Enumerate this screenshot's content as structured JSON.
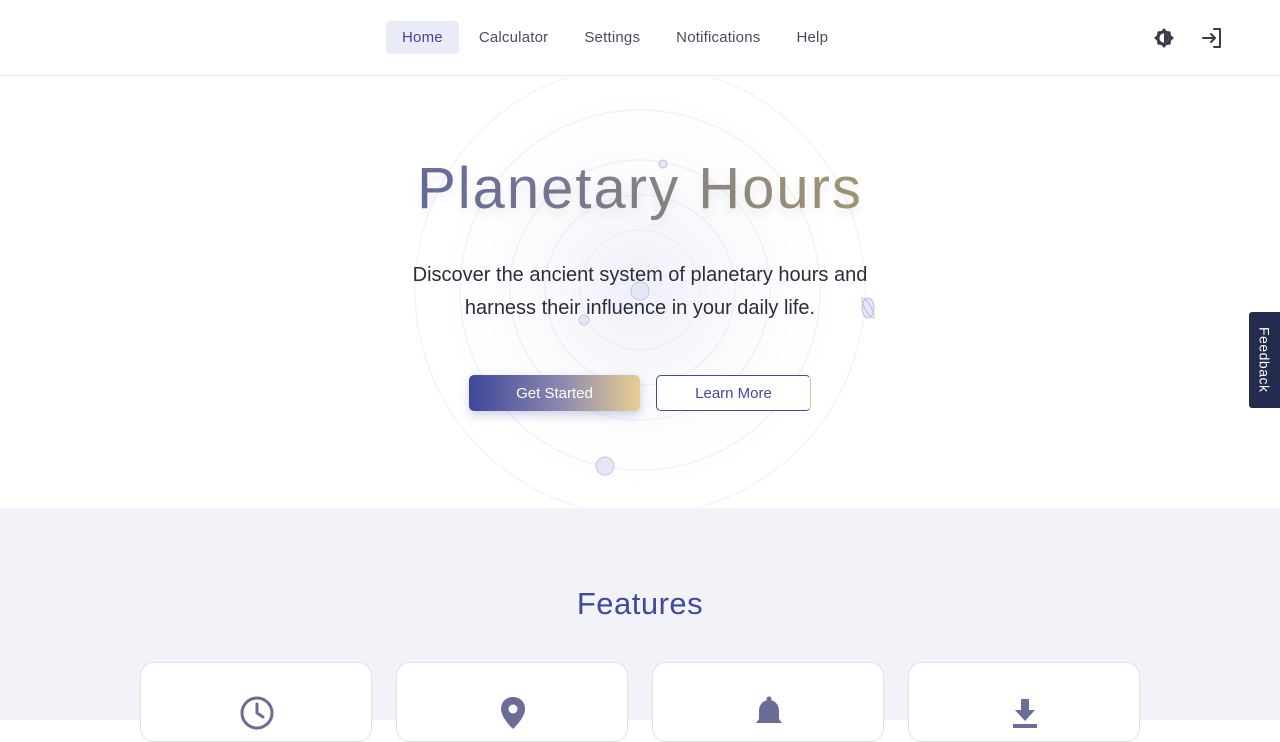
{
  "nav": {
    "items": [
      {
        "label": "Home",
        "active": true
      },
      {
        "label": "Calculator",
        "active": false
      },
      {
        "label": "Settings",
        "active": false
      },
      {
        "label": "Notifications",
        "active": false
      },
      {
        "label": "Help",
        "active": false
      }
    ],
    "icons": [
      "theme-toggle-icon",
      "login-icon"
    ]
  },
  "hero": {
    "title": "Planetary Hours",
    "subtitle": "Discover the ancient system of planetary hours and harness their influence in your daily life.",
    "primary_button": "Get Started",
    "secondary_button": "Learn More"
  },
  "feedback_tab": "Feedback",
  "features": {
    "title": "Features",
    "card_icons": [
      "clock-icon",
      "location-pin-icon",
      "bell-icon",
      "download-icon"
    ]
  },
  "colors": {
    "primary": "#3f4a9c",
    "gold": "#d7c48a",
    "feedback_bg": "#232b4f",
    "section_bg": "#f2f3f8"
  }
}
